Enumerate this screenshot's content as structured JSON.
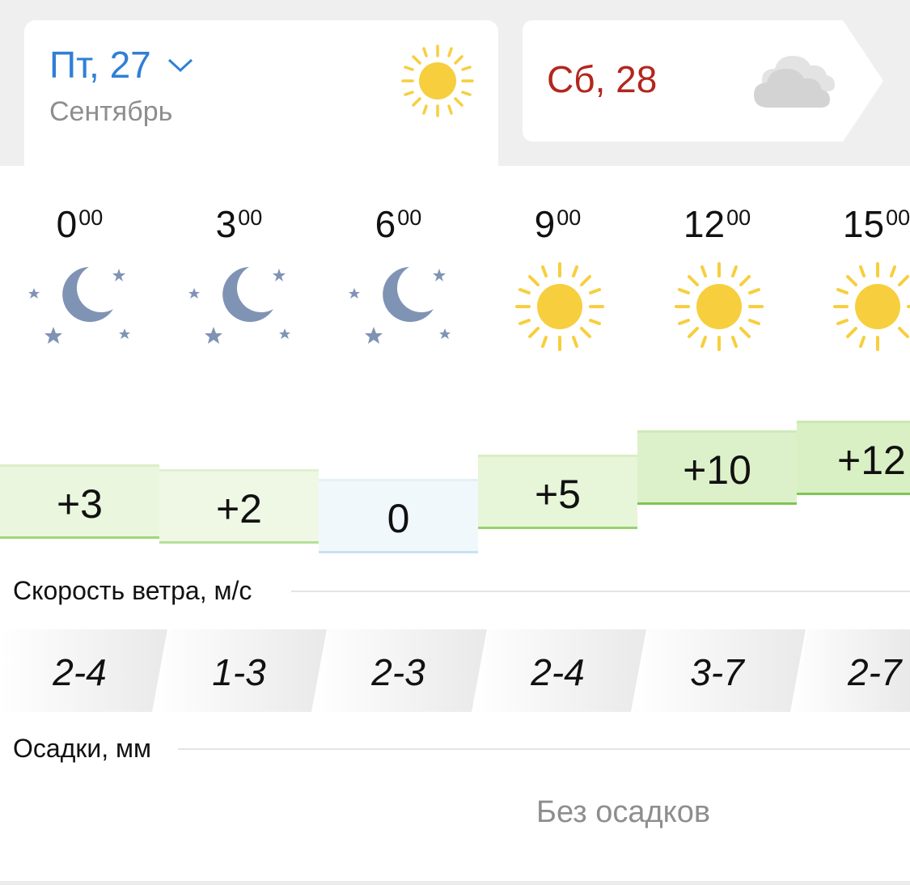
{
  "days": {
    "active": {
      "label": "Пт, 27",
      "month": "Сентябрь",
      "icon": "sun-icon",
      "color": "#2f7fd6"
    },
    "next": {
      "label": "Сб, 28",
      "icon": "cloud-icon",
      "color": "#b3261e"
    }
  },
  "hours": [
    {
      "hour": "0",
      "minutes": "00",
      "icon": "moon-stars-icon",
      "temp": "+3",
      "wind": "2-4"
    },
    {
      "hour": "3",
      "minutes": "00",
      "icon": "moon-stars-icon",
      "temp": "+2",
      "wind": "1-3"
    },
    {
      "hour": "6",
      "minutes": "00",
      "icon": "moon-stars-icon",
      "temp": "0",
      "wind": "2-3"
    },
    {
      "hour": "9",
      "minutes": "00",
      "icon": "sun-icon",
      "temp": "+5",
      "wind": "2-4"
    },
    {
      "hour": "12",
      "minutes": "00",
      "icon": "sun-icon",
      "temp": "+10",
      "wind": "3-7"
    },
    {
      "hour": "15",
      "minutes": "00",
      "icon": "sun-icon",
      "temp": "+12",
      "wind": "2-7"
    }
  ],
  "wind_section": {
    "label": "Скорость ветра, м/с"
  },
  "precip_section": {
    "label": "Осадки, мм",
    "value": "Без осадков"
  }
}
